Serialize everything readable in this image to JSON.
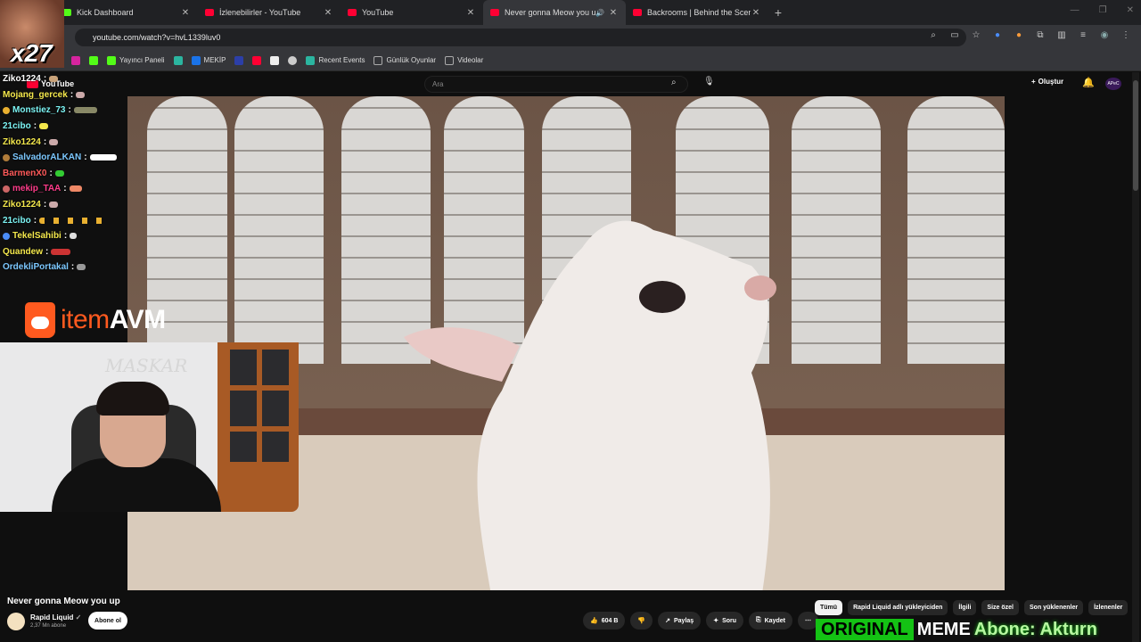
{
  "browser": {
    "tabs": [
      {
        "title": "Kick Dashboard",
        "active": false
      },
      {
        "title": "İzlenebilirler - YouTube",
        "active": false
      },
      {
        "title": "YouTube",
        "active": false
      },
      {
        "title": "Never gonna Meow you up",
        "active": true
      },
      {
        "title": "Backrooms | Behind the Scenes",
        "active": false
      }
    ],
    "new_tab": "+",
    "url": "youtube.com/watch?v=hvL1339luv0",
    "bookmarks": [
      {
        "label": "Yayıncı Paneli",
        "color": "#53fc18"
      },
      {
        "label": "MEKİP",
        "color": "#1a73e8"
      },
      {
        "label": "Recent Events",
        "color": "#2bb5a0"
      },
      {
        "label": "Günlük Oyunlar",
        "color": "#aaaaaa"
      },
      {
        "label": "Videolar",
        "color": "#aaaaaa"
      }
    ]
  },
  "youtube": {
    "logo": "YouTube",
    "search_placeholder": "Ara",
    "create_label": "Oluştur",
    "avatar_label": "APeC"
  },
  "overlay": {
    "counter": "x27",
    "brand_a": "item",
    "brand_b": "AVM",
    "webcam_watermark": "MASKAR",
    "chat": [
      {
        "user": "Ziko1224",
        "color": "#ffffff",
        "emote": "#c9a37a"
      },
      {
        "user": "Mojang_gercek",
        "color": "#f4e84c",
        "emote": "#caa"
      },
      {
        "user": "Monstiez_73",
        "color": "#7cf4f4",
        "emote": "#886"
      },
      {
        "user": "21cibo",
        "color": "#7cf4f4",
        "emote": "#f4e84c"
      },
      {
        "user": "Ziko1224",
        "color": "#f4e84c",
        "emote": "#caa"
      },
      {
        "user": "SalvadorALKAN",
        "color": "#7cc8ff",
        "emote": "#fff"
      },
      {
        "user": "BarmenX0",
        "color": "#ff5a5a",
        "emote": "#3c3"
      },
      {
        "user": "mekip_TAA",
        "color": "#ff3c8a",
        "emote": "#e86"
      },
      {
        "user": "Ziko1224",
        "color": "#f4e84c",
        "emote": "#caa"
      },
      {
        "user": "21cibo",
        "color": "#7cf4f4",
        "emote": "#e9b030"
      },
      {
        "user": "TekelSahibi",
        "color": "#f4e84c",
        "emote": "#ddd"
      },
      {
        "user": "Quandew",
        "color": "#f4e84c",
        "emote": "#c33"
      },
      {
        "user": "OrdekliPortakal",
        "color": "#7cc8ff",
        "emote": "#999"
      }
    ],
    "banner_a": "ORIGINAL",
    "banner_b": "MEME",
    "banner_c": "Abone: Akturn"
  },
  "video": {
    "title": "Never gonna Meow you up",
    "channel": "Rapid Liquid",
    "subscribers": "2,37 Mn abone",
    "subscribe_label": "Abone ol",
    "likes": "604 B",
    "share_label": "Paylaş",
    "ask_label": "Soru",
    "save_label": "Kaydet"
  },
  "filters": [
    "Tümü",
    "Rapid Liquid adlı yükleyiciden",
    "İlgili",
    "Size özel",
    "Son yüklenenler",
    "İzlenenler"
  ]
}
